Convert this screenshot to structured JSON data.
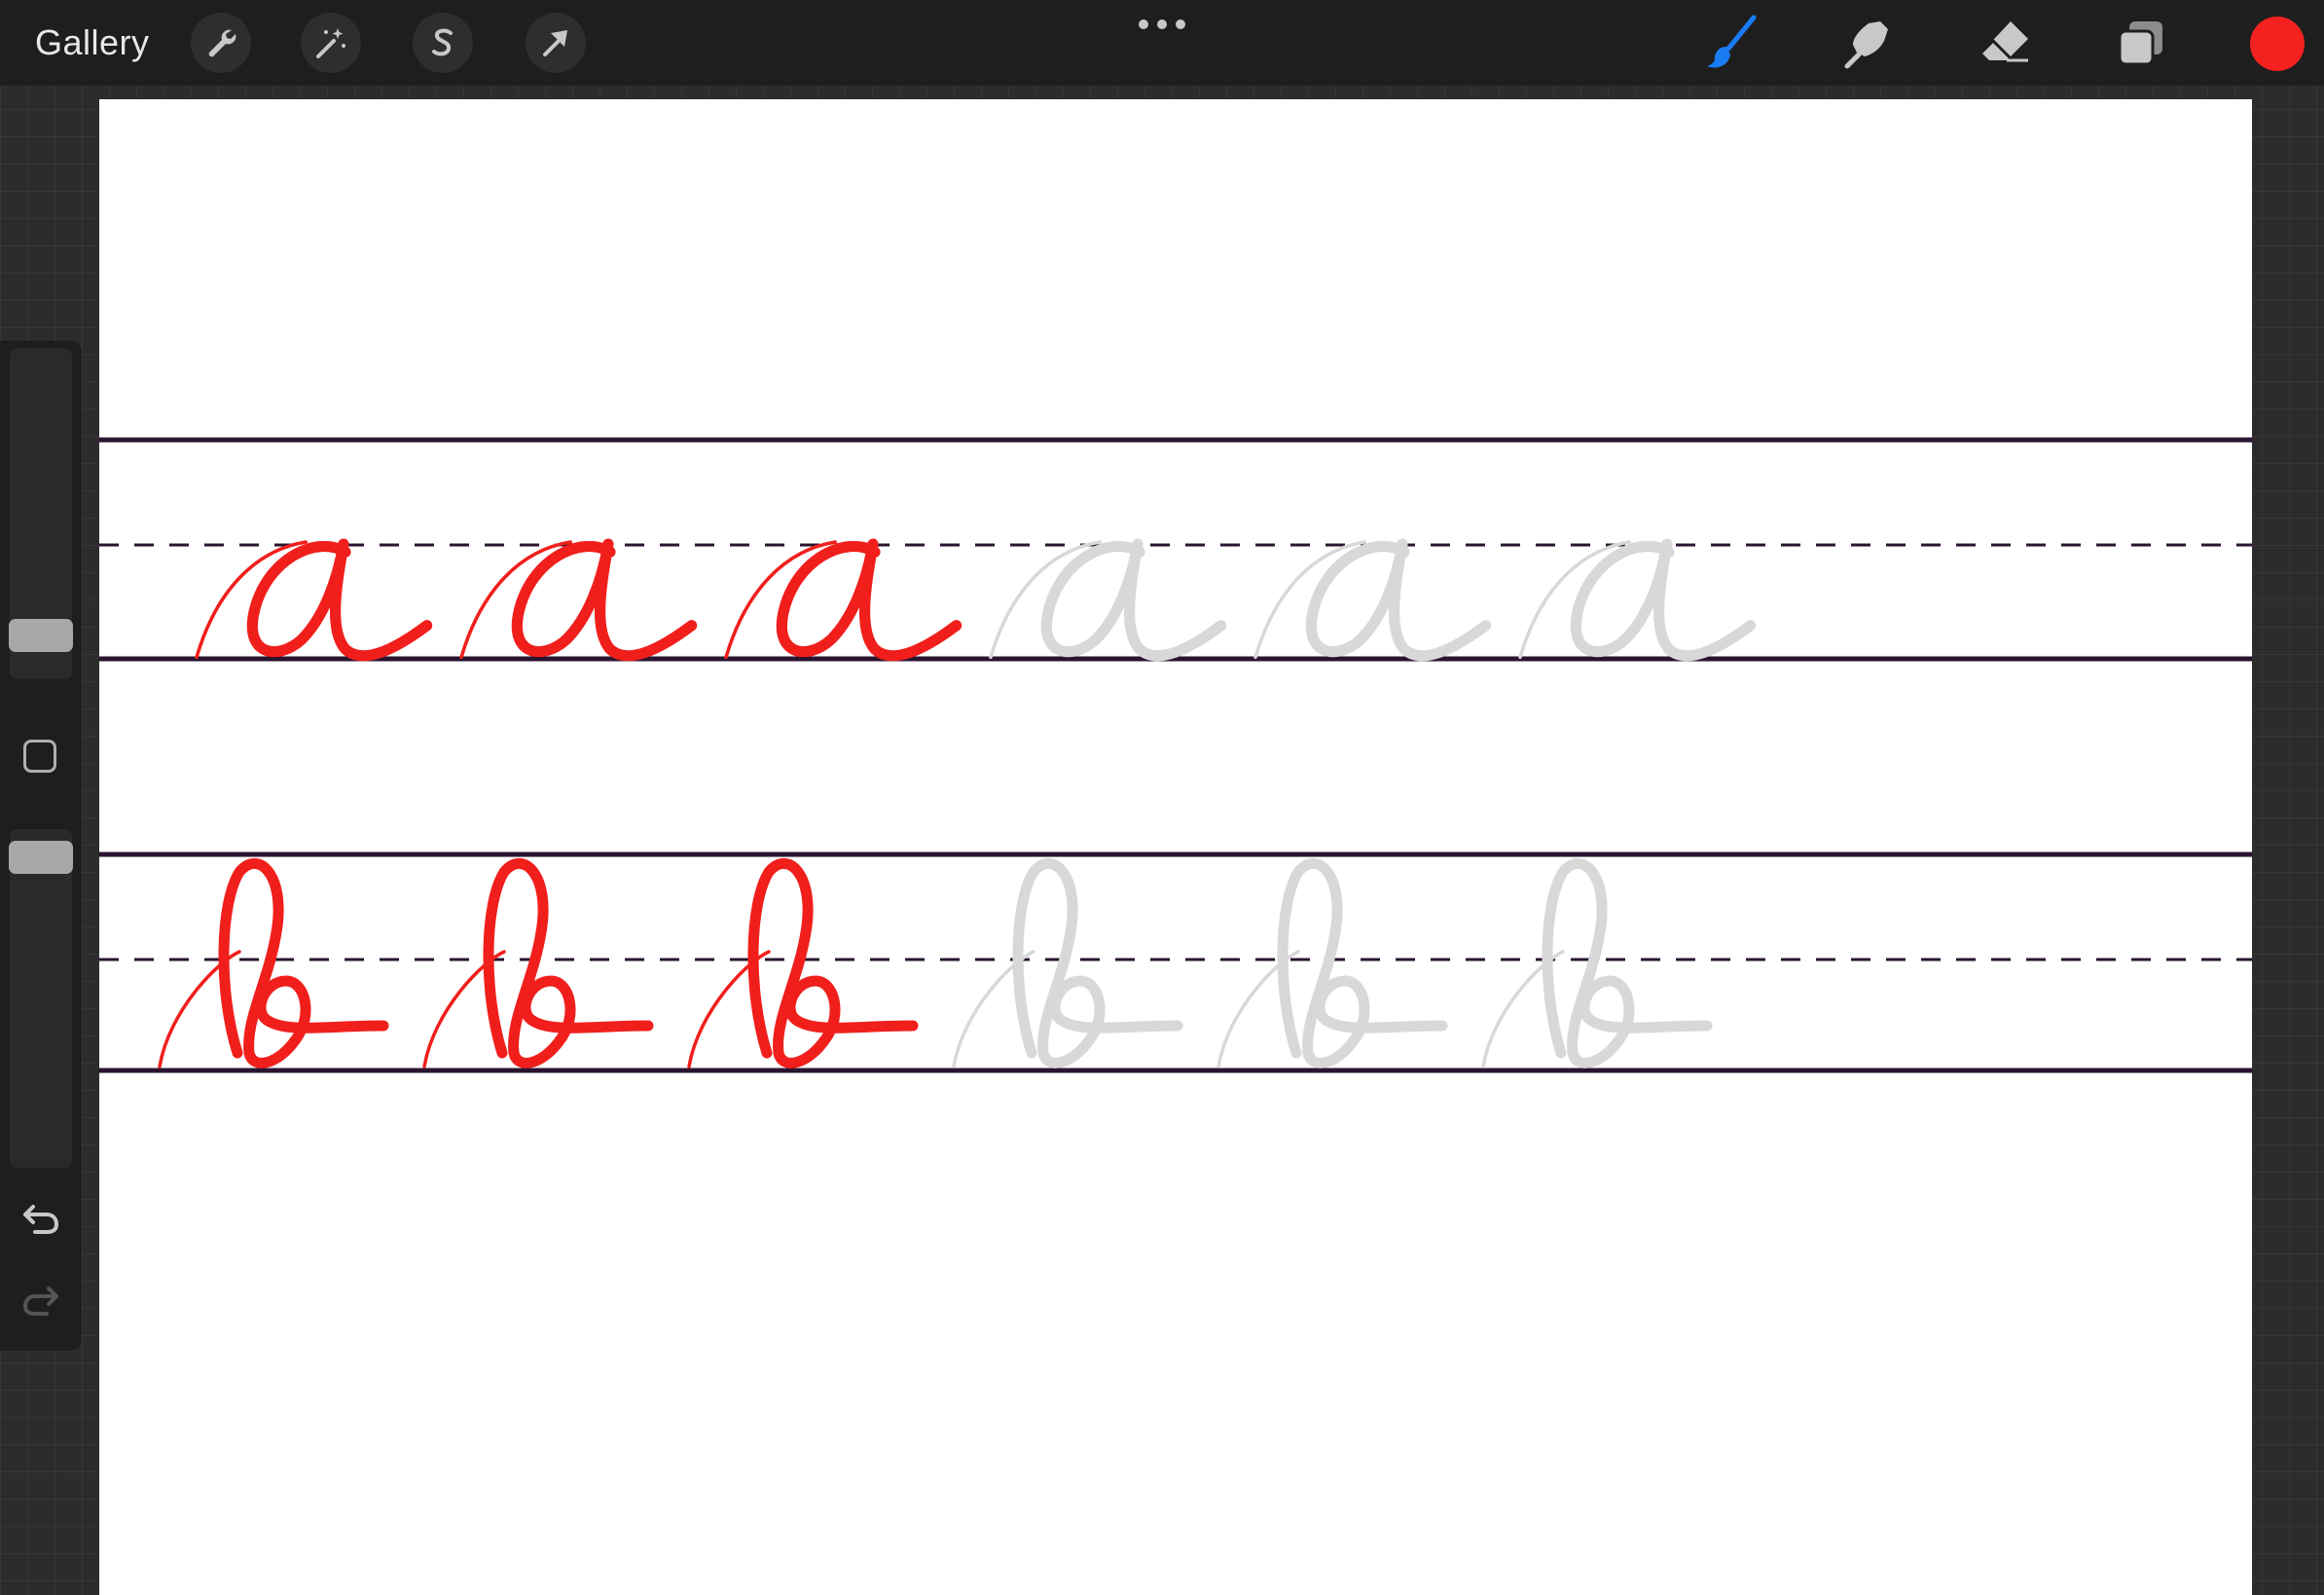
{
  "app": {
    "gallery_label": "Gallery"
  },
  "toolbar": {
    "left_tools": [
      {
        "name": "actions",
        "icon": "wrench-icon"
      },
      {
        "name": "adjustments",
        "icon": "magic-wand-icon"
      },
      {
        "name": "selection",
        "icon": "selection-s-icon"
      },
      {
        "name": "transform",
        "icon": "arrow-cursor-icon"
      }
    ],
    "more_icon": "more-dots-icon",
    "right_tools": [
      {
        "name": "brush",
        "icon": "paintbrush-icon",
        "active": true
      },
      {
        "name": "smudge",
        "icon": "smudge-finger-icon",
        "active": false
      },
      {
        "name": "eraser",
        "icon": "eraser-icon",
        "active": false
      },
      {
        "name": "layers",
        "icon": "layers-icon",
        "active": false
      }
    ],
    "current_color": "#f5211f"
  },
  "sidebar": {
    "brush_size_icon": "slider-thumb",
    "opacity_icon": "slider-thumb",
    "modify_icon": "square-modify-icon",
    "undo_icon": "undo-icon",
    "redo_icon": "redo-icon",
    "redo_enabled": false
  },
  "canvas": {
    "background": "#ffffff",
    "guide_line_color": "#2a1430",
    "ink_color": "#f01f1c",
    "trace_color": "#d8d8d8",
    "rows": [
      {
        "letter": "a",
        "inked_count": 3,
        "trace_count": 3
      },
      {
        "letter": "b",
        "inked_count": 3,
        "trace_count": 3
      }
    ]
  },
  "colors": {
    "topbar": "#1e1e1e",
    "accent_blue": "#1a7cf5",
    "icon_gray": "#c8c8c8"
  }
}
